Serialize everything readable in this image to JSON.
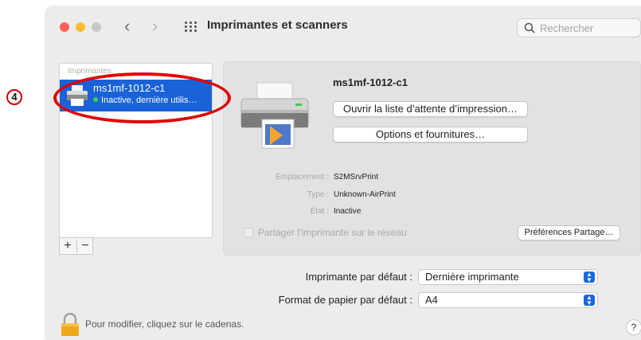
{
  "colors": {
    "accent": "#1a62d7",
    "close": "#ff5f57",
    "minimize": "#febc2e",
    "zoom": "#c7c7c7",
    "annotation": "#e00000",
    "status_ok": "#3ccf4e"
  },
  "window": {
    "title": "Imprimantes et scanners",
    "back_icon": "chevron-left-icon",
    "forward_icon": "chevron-right-icon",
    "grid_icon": "grid-icon"
  },
  "search": {
    "placeholder": "Rechercher",
    "icon": "search-icon"
  },
  "sidebar": {
    "header": "Imprimantes",
    "items": [
      {
        "name": "ms1mf-1012-c1",
        "status": "Inactive, dernière utilis…",
        "icon": "printer-icon"
      }
    ],
    "add_label": "+",
    "remove_label": "−"
  },
  "detail": {
    "printer_name": "ms1mf-1012-c1",
    "open_queue_label": "Ouvrir la liste d’attente d’impression…",
    "options_label": "Options et fournitures…",
    "info": [
      {
        "label": "Emplacement :",
        "value": "S2MSrvPrint"
      },
      {
        "label": "Type :",
        "value": "Unknown-AirPrint"
      },
      {
        "label": "État :",
        "value": "Inactive"
      }
    ],
    "share_label": "Partager l’imprimante sur le réseau",
    "share_checked": false,
    "share_prefs_label": "Préférences Partage…"
  },
  "defaults": {
    "printer_label": "Imprimante par défaut :",
    "printer_value": "Dernière imprimante",
    "paper_label": "Format de papier par défaut :",
    "paper_value": "A4"
  },
  "footer": {
    "lock_text": "Pour modifier, cliquez sur le cadenas.",
    "lock_icon": "padlock-icon",
    "help_label": "?"
  },
  "annotation": {
    "step_number": "4"
  }
}
